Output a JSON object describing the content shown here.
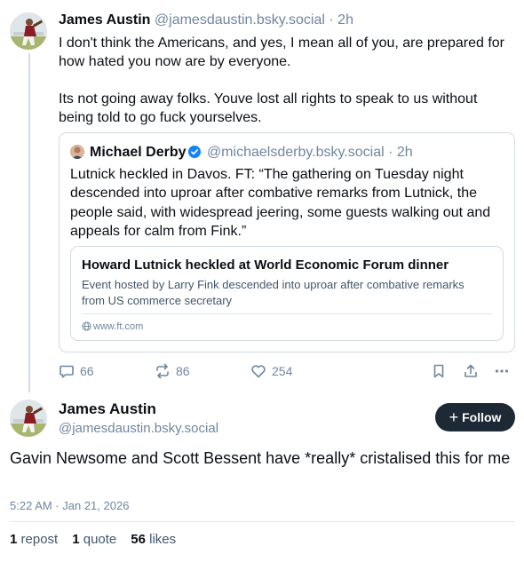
{
  "parent_post": {
    "author_name": "James Austin",
    "handle": "@jamesdaustin.bsky.social",
    "separator": "·",
    "time": "2h",
    "paragraphs": [
      "I don't think the Americans, and yes, I mean all of you, are prepared for how hated you now are by everyone.",
      "Its not going away folks. Youve lost all rights to speak to us without being told to go fuck yourselves."
    ],
    "quote": {
      "author_name": "Michael Derby",
      "handle": "@michaelsderby.bsky.social",
      "separator": "·",
      "time": "2h",
      "verified_color": "#1083fe",
      "text": "Lutnick heckled in Davos. FT: “The gathering on Tuesday night descended into uproar after combative remarks from Lutnick, the people said, with widespread jeering, some guests walking out and appeals for calm from Fink.”",
      "link_card": {
        "title": "Howard Lutnick heckled at World Economic Forum dinner",
        "description": "Event hosted by Larry Fink descended into uproar after combative remarks from US commerce secretary",
        "domain": "www.ft.com"
      }
    },
    "actions": {
      "reply_count": "66",
      "repost_count": "86",
      "like_count": "254"
    }
  },
  "focused_post": {
    "author_name": "James Austin",
    "handle": "@jamesdaustin.bsky.social",
    "follow_label": "Follow",
    "text": "Gavin Newsome and Scott Bessent have *really* cristalised this for me",
    "timestamp": "5:22 AM · Jan 21, 2026",
    "stats": {
      "reposts_count": "1",
      "reposts_label": "repost",
      "quotes_count": "1",
      "quotes_label": "quote",
      "likes_count": "56",
      "likes_label": "likes"
    }
  },
  "colors": {
    "text": "#0b0f14",
    "muted": "#6f869f",
    "border": "#d4dbe2",
    "follow_button": "#1e2936",
    "verified": "#1083fe"
  },
  "icons": {
    "reply": "speech-bubble-icon",
    "repost": "repost-arrows-icon",
    "like": "heart-icon",
    "bookmark": "bookmark-icon",
    "share": "share-icon",
    "more": "ellipsis-icon",
    "globe": "globe-icon",
    "verified": "verified-check-icon"
  }
}
